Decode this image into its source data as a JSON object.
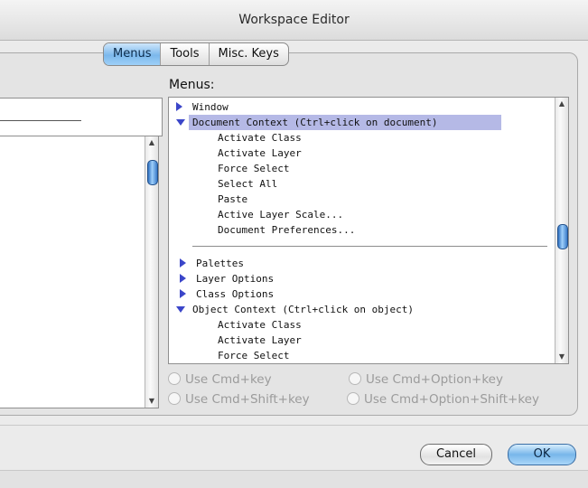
{
  "window": {
    "title": "Workspace Editor"
  },
  "tabs": [
    {
      "label": "Menus",
      "active": true
    },
    {
      "label": "Tools",
      "active": false
    },
    {
      "label": "Misc. Keys",
      "active": false
    }
  ],
  "menus_panel": {
    "label": "Menus:",
    "items": [
      {
        "text": "Window",
        "indent": 0,
        "disclosure": "collapsed",
        "selected": false
      },
      {
        "text": "Document Context (Ctrl+click on document)",
        "indent": 0,
        "disclosure": "expanded",
        "selected": true
      },
      {
        "text": "Activate Class",
        "indent": 2,
        "disclosure": "none",
        "selected": false
      },
      {
        "text": "Activate Layer",
        "indent": 2,
        "disclosure": "none",
        "selected": false
      },
      {
        "text": "Force Select",
        "indent": 2,
        "disclosure": "none",
        "selected": false
      },
      {
        "text": "Select All",
        "indent": 2,
        "disclosure": "none",
        "selected": false
      },
      {
        "text": "Paste",
        "indent": 2,
        "disclosure": "none",
        "selected": false
      },
      {
        "text": "Active Layer Scale...",
        "indent": 2,
        "disclosure": "none",
        "selected": false
      },
      {
        "text": "Document Preferences...",
        "indent": 2,
        "disclosure": "none",
        "selected": false
      },
      {
        "text": "",
        "indent": 0,
        "disclosure": "separator",
        "selected": false
      },
      {
        "text": "Palettes",
        "indent": 1,
        "disclosure": "collapsed",
        "selected": false
      },
      {
        "text": "Layer Options",
        "indent": 1,
        "disclosure": "collapsed",
        "selected": false
      },
      {
        "text": "Class Options",
        "indent": 1,
        "disclosure": "collapsed",
        "selected": false
      },
      {
        "text": "Object Context (Ctrl+click on object)",
        "indent": 0,
        "disclosure": "expanded",
        "selected": false
      },
      {
        "text": "Activate Class",
        "indent": 2,
        "disclosure": "none",
        "selected": false
      },
      {
        "text": "Activate Layer",
        "indent": 2,
        "disclosure": "none",
        "selected": false
      },
      {
        "text": "Force Select",
        "indent": 2,
        "disclosure": "none",
        "selected": false
      }
    ]
  },
  "shortcut_options": {
    "cmd_key": "Use Cmd+key",
    "cmd_option_key": "Use Cmd+Option+key",
    "cmd_shift_key": "Use Cmd+Shift+key",
    "cmd_option_shift_key": "Use Cmd+Option+Shift+key"
  },
  "buttons": {
    "cancel": "Cancel",
    "ok": "OK"
  },
  "colors": {
    "selection": "#b5b9e6",
    "accent": "#78b7ea",
    "disclosure": "#3b46c9"
  },
  "icons": {
    "collapsed": "triangle-right-icon",
    "expanded": "triangle-down-icon",
    "scroll_up": "scroll-up-arrow-icon",
    "scroll_down": "scroll-down-arrow-icon"
  }
}
